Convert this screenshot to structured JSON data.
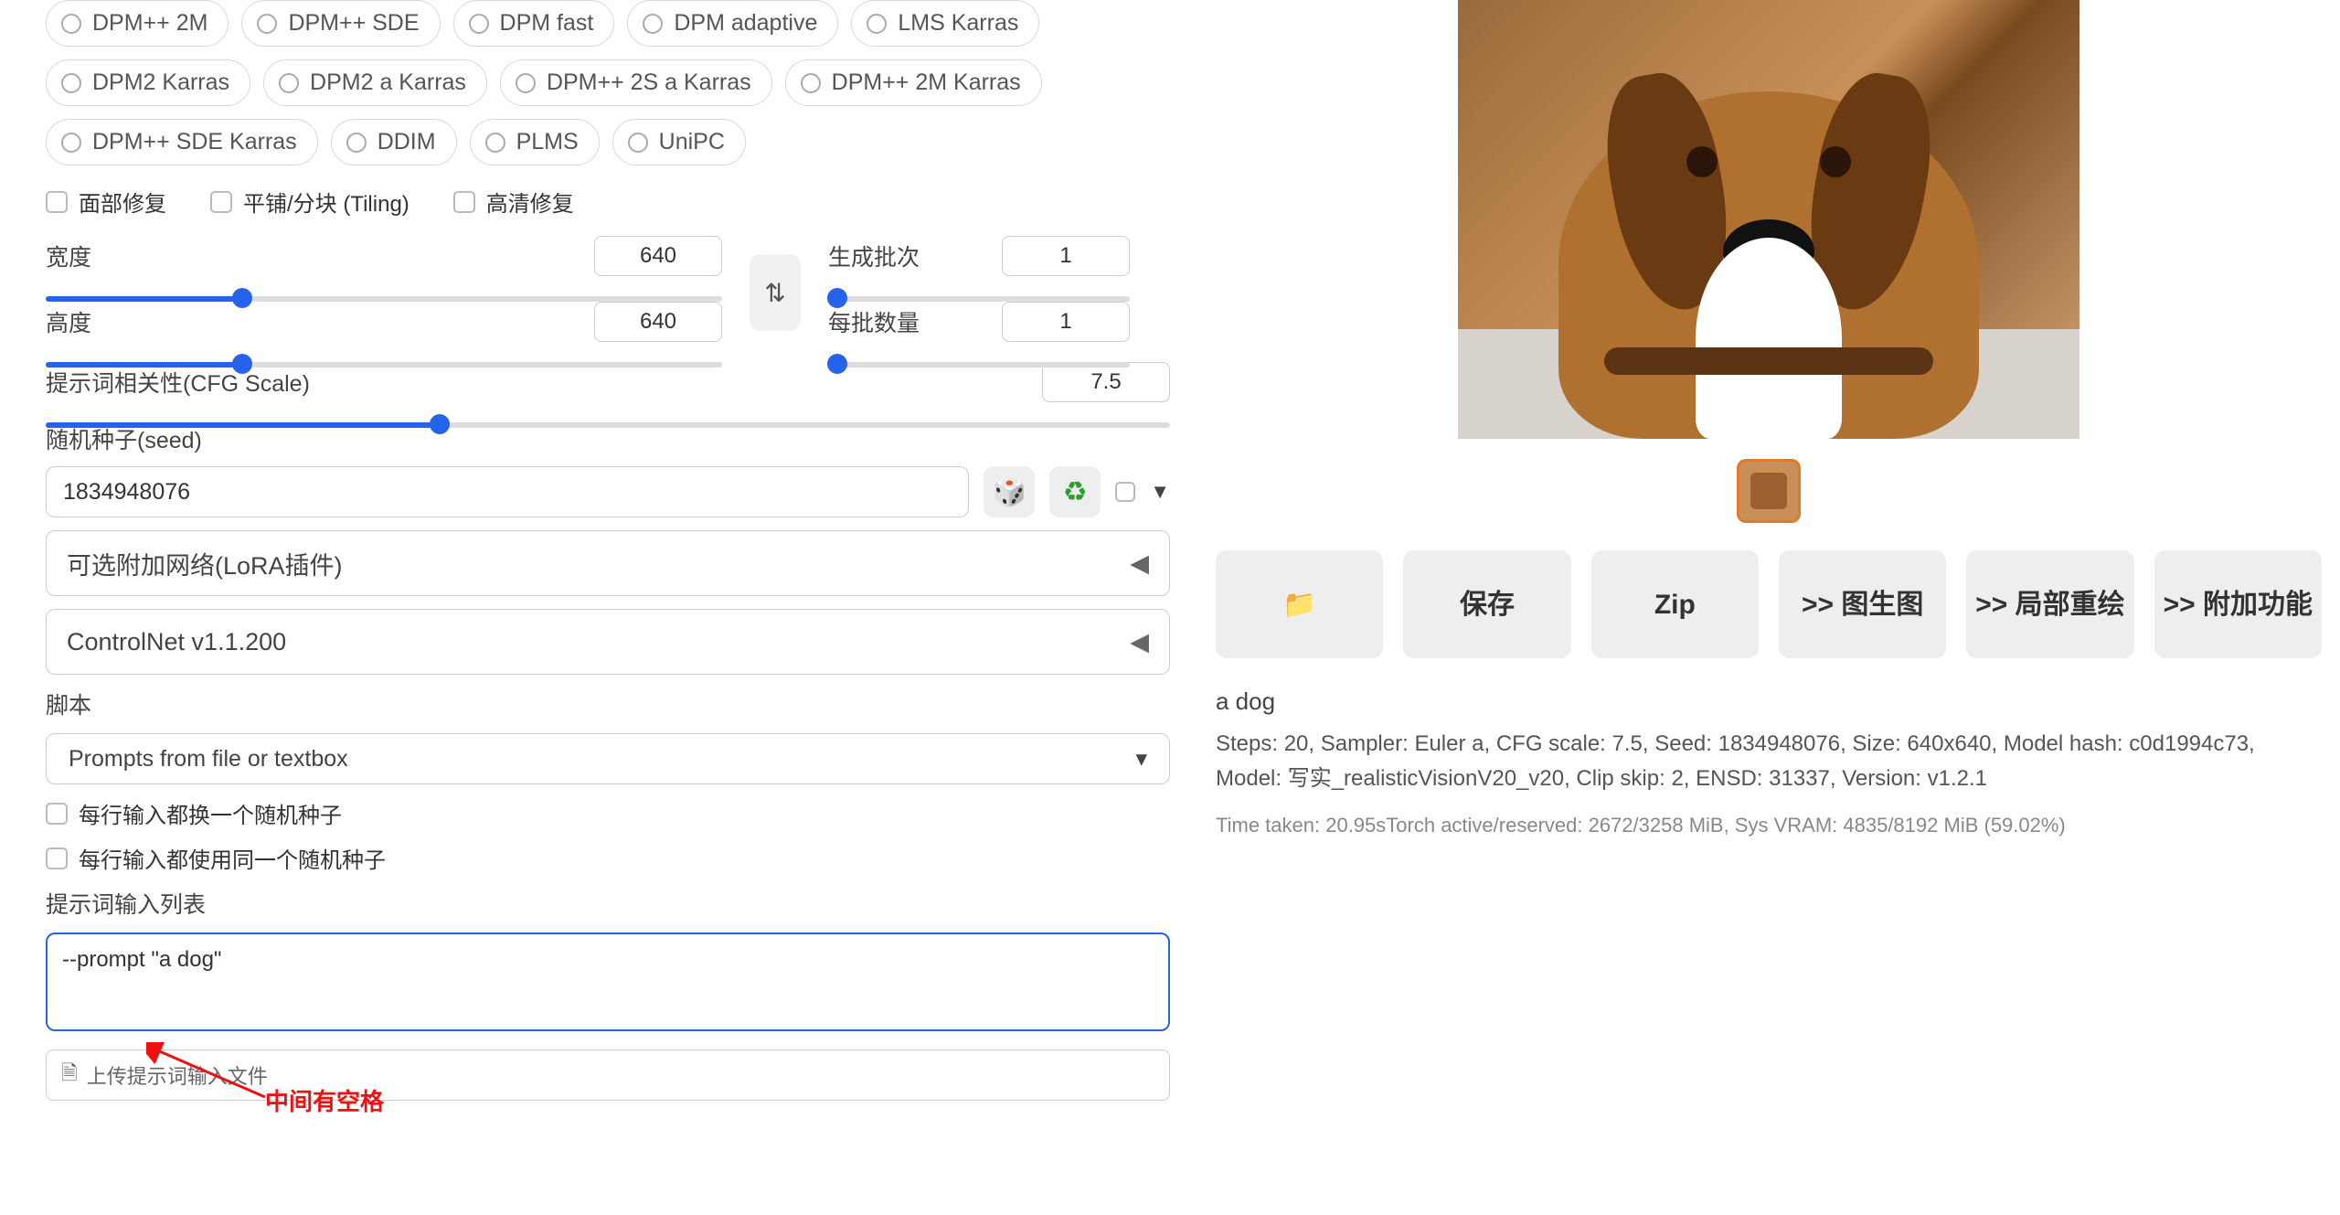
{
  "samplers": [
    "DPM++ 2M",
    "DPM++ SDE",
    "DPM fast",
    "DPM adaptive",
    "LMS Karras",
    "DPM2 Karras",
    "DPM2 a Karras",
    "DPM++ 2S a Karras",
    "DPM++ 2M Karras",
    "DPM++ SDE Karras",
    "DDIM",
    "PLMS",
    "UniPC"
  ],
  "checks": {
    "face": "面部修复",
    "tiling": "平铺/分块 (Tiling)",
    "hires": "高清修复"
  },
  "dim": {
    "width_label": "宽度",
    "width_val": "640",
    "width_pct": 29,
    "height_label": "高度",
    "height_val": "640",
    "height_pct": 29
  },
  "batch": {
    "count_label": "生成批次",
    "count_val": "1",
    "count_pct": 3,
    "size_label": "每批数量",
    "size_val": "1",
    "size_pct": 3
  },
  "cfg": {
    "label": "提示词相关性(CFG Scale)",
    "val": "7.5",
    "pct": 35
  },
  "seed": {
    "label": "随机种子(seed)",
    "val": "1834948076"
  },
  "swap_icon": "⇅",
  "dice_icon": "🎲",
  "recycle_icon": "♻",
  "tri_down": "▼",
  "accordions": {
    "lora": "可选附加网络(LoRA插件)",
    "controlnet": "ControlNet v1.1.200"
  },
  "tri_left": "◀",
  "script_label": "脚本",
  "script_value": "Prompts from file or textbox",
  "script_tri": "▾",
  "script_cb1": "每行输入都换一个随机种子",
  "script_cb2": "每行输入都使用同一个随机种子",
  "prompt_list_label": "提示词输入列表",
  "prompt_ta": "--prompt \"a dog\"",
  "upload_label": "上传提示词输入文件",
  "upload_icon": "🗎",
  "annotation": "中间有空格",
  "out_buttons": {
    "folder": "📁",
    "save": "保存",
    "zip": "Zip",
    "img2img": ">> 图生图",
    "inpaint": ">> 局部重绘",
    "extras": ">> 附加功能"
  },
  "info_prompt": "a dog",
  "info_meta": "Steps: 20, Sampler: Euler a, CFG scale: 7.5, Seed: 1834948076, Size: 640x640, Model hash: c0d1994c73, Model: 写实_realisticVisionV20_v20, Clip skip: 2, ENSD: 31337, Version: v1.2.1",
  "info_time": "Time taken: 20.95sTorch active/reserved: 2672/3258 MiB, Sys VRAM: 4835/8192 MiB (59.02%)"
}
